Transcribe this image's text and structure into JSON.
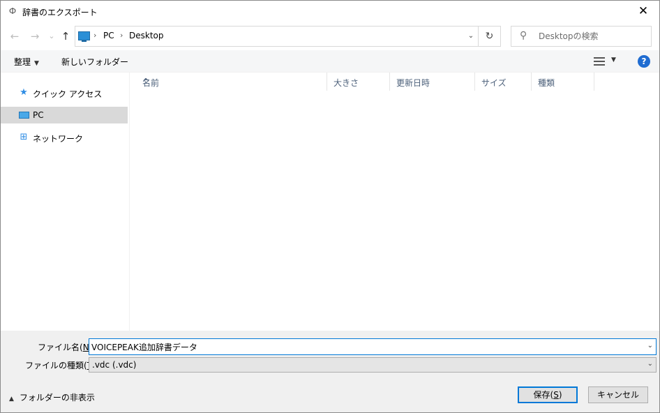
{
  "window": {
    "title": "辞書のエクスポート",
    "close_label": "✕"
  },
  "nav": {
    "back": "←",
    "forward": "→",
    "recent": "⌄",
    "up": "↑",
    "breadcrumbs": [
      "PC",
      "Desktop"
    ],
    "breadcrumb_sep": "›",
    "address_dropdown": "⌄",
    "refresh": "↻"
  },
  "search": {
    "placeholder": "Desktopの検索"
  },
  "toolbar": {
    "organize": "整理",
    "new_folder": "新しいフォルダー",
    "help": "?"
  },
  "sidebar": {
    "items": [
      {
        "label": "クイック アクセス",
        "icon": "star-icon"
      },
      {
        "label": "PC",
        "icon": "computer-icon",
        "selected": true
      },
      {
        "label": "ネットワーク",
        "icon": "network-icon"
      }
    ]
  },
  "columns": [
    "名前",
    "大きさ",
    "更新日時",
    "サイズ",
    "種類"
  ],
  "bottom": {
    "filename_label": "ファイル名(",
    "filename_hotkey": "N",
    "filename_label_end": "):",
    "filename_value": "VOICEPEAK追加辞書データ",
    "filetype_label": "ファイルの種類(",
    "filetype_hotkey": "T",
    "filetype_label_end": "):",
    "filetype_value": ".vdc (.vdc)",
    "hide_folders": "フォルダーの非表示",
    "save_label": "保存(",
    "save_hotkey": "S",
    "save_label_end": ")",
    "cancel_label": "キャンセル"
  },
  "colors": {
    "accent": "#0078d7",
    "selected_bg": "#d9d9d9",
    "header_text": "#4c607a",
    "help_blue": "#1f6cd1"
  }
}
